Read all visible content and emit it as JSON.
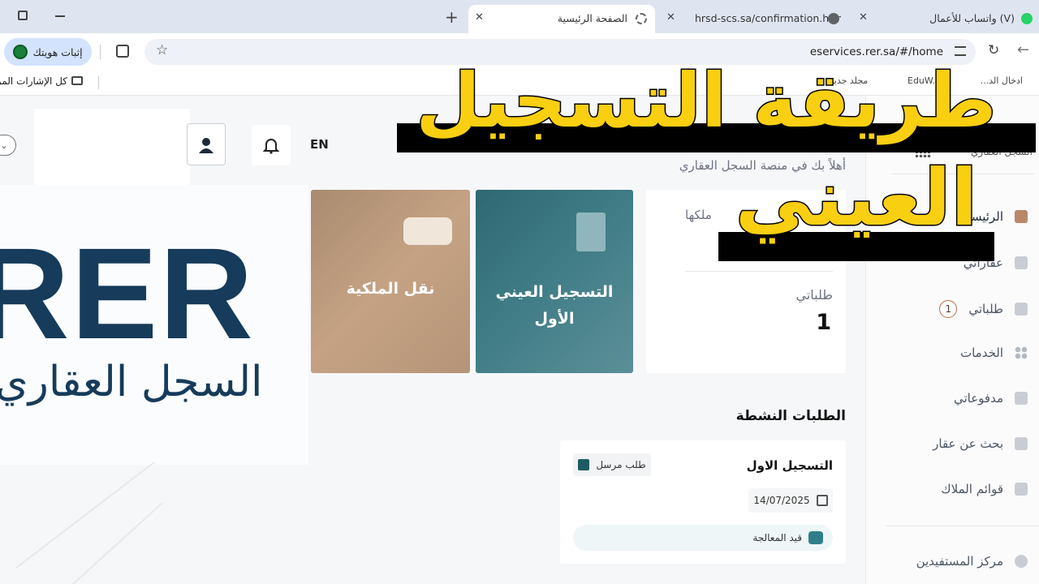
{
  "browser": {
    "tabs": [
      {
        "title": "(V) واتساب للأعمال"
      },
      {
        "title": "hrsd-scs.sa/confirmation.html?c"
      },
      {
        "title": "الصفحة الرئيسية"
      }
    ],
    "url": "eservices.rer.sa/#/home",
    "identity_button": "إثبات هويتك",
    "bookmarks": [
      {
        "label": "ادخال الد..."
      },
      {
        "label": "EduW..."
      },
      {
        "label": "مجلد جديد"
      },
      {
        "label": "كل الإشارات المرجعية"
      }
    ]
  },
  "header": {
    "lang": "EN",
    "welcome": "أهلاً بك في منصة السجل العقاري",
    "platform_name": "السجل العقاري"
  },
  "sidebar": {
    "items": [
      {
        "label": "الرئيسية",
        "icon": "home-icon"
      },
      {
        "label": "عقاراتي",
        "icon": "building-icon"
      },
      {
        "label": "طلباتي",
        "icon": "requests-icon",
        "badge": "1"
      },
      {
        "label": "الخدمات",
        "icon": "grid-icon"
      },
      {
        "label": "مدفوعاتي",
        "icon": "card-icon"
      },
      {
        "label": "بحث عن عقار",
        "icon": "search-icon"
      },
      {
        "label": "قوائم الملاك",
        "icon": "list-icon"
      },
      {
        "label": "مركز المستفيدين",
        "icon": "help-icon"
      }
    ]
  },
  "main": {
    "props_text": "ملكها",
    "requests_label": "طلباتي",
    "requests_count": "1",
    "tile_first_registration": {
      "line1": "التسجيل العيني",
      "line2": "الأول"
    },
    "tile_transfer": "نقل الملكية",
    "active_requests_title": "الطلبات النشطة",
    "request_card": {
      "title": "التسجيل الاول",
      "type_badge": "طلب مرسل",
      "date": "14/07/2025",
      "status": "قيد المعالجة"
    }
  },
  "overlay": {
    "title_line1": "طريقة التسجيل",
    "title_line2": "العيني",
    "logo_letters": "RER",
    "logo_subtitle": "السجل العقاري"
  },
  "colors": {
    "tile_teal": "#3f7c86",
    "tile_tan": "#c5a284",
    "logo_navy": "#163b5b",
    "overlay_yellow": "#f9cf12"
  }
}
